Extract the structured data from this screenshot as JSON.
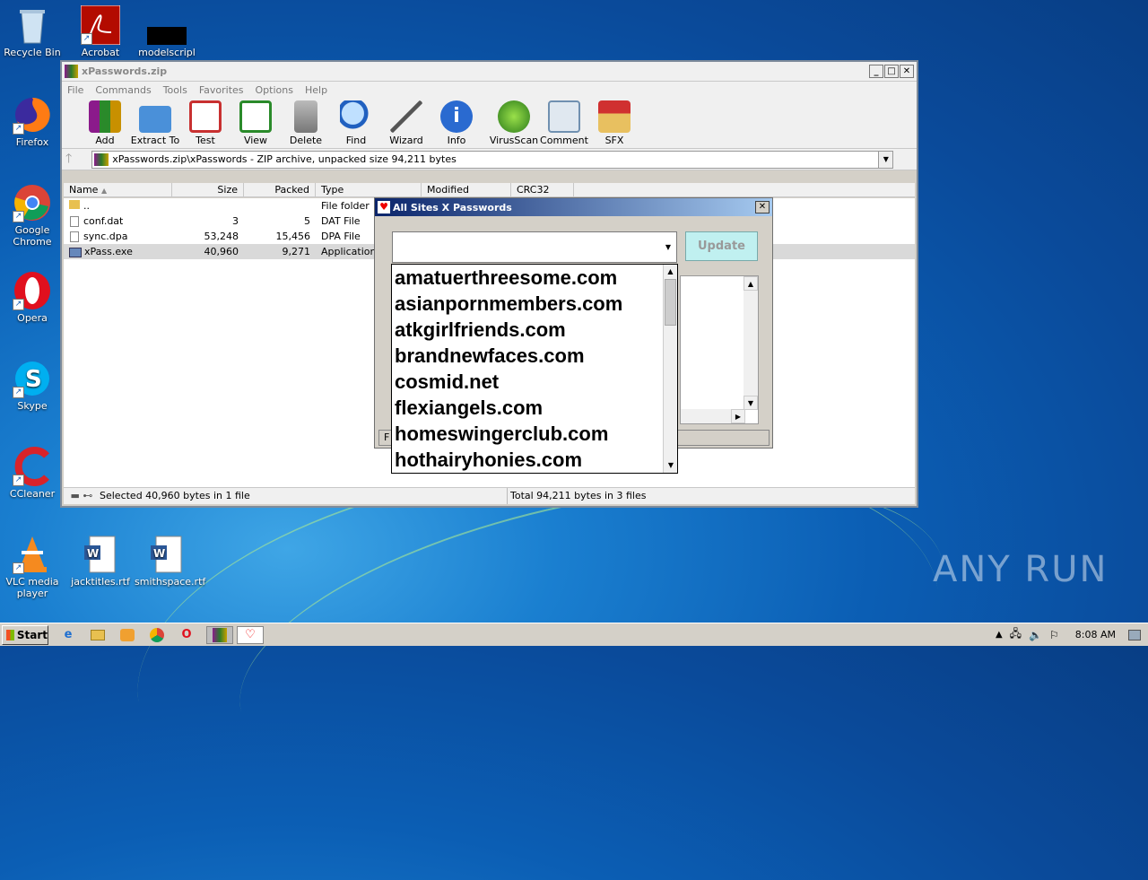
{
  "desktop": {
    "icons": [
      {
        "label": "Recycle Bin",
        "icon": "recycle-bin-icon"
      },
      {
        "label": "Acrobat",
        "icon": "acrobat-icon"
      },
      {
        "label": "modelscripl",
        "icon": "black-box-icon"
      },
      {
        "label": "Firefox",
        "icon": "firefox-icon"
      },
      {
        "label": "Google Chrome",
        "icon": "chrome-icon"
      },
      {
        "label": "Opera",
        "icon": "opera-icon"
      },
      {
        "label": "Skype",
        "icon": "skype-icon"
      },
      {
        "label": "CCleaner",
        "icon": "ccleaner-icon"
      },
      {
        "label": "VLC media player",
        "icon": "vlc-icon"
      },
      {
        "label": "jacktitles.rtf",
        "icon": "word-doc-icon"
      },
      {
        "label": "smithspace.rtf",
        "icon": "word-doc-icon"
      }
    ]
  },
  "winrar": {
    "title": "xPasswords.zip",
    "menu": [
      "File",
      "Commands",
      "Tools",
      "Favorites",
      "Options",
      "Help"
    ],
    "toolbar": [
      "Add",
      "Extract To",
      "Test",
      "View",
      "Delete",
      "Find",
      "Wizard",
      "Info",
      "VirusScan",
      "Comment",
      "SFX"
    ],
    "address": "xPasswords.zip\\xPasswords - ZIP archive, unpacked size 94,211 bytes",
    "columns": [
      "Name",
      "Size",
      "Packed",
      "Type",
      "Modified",
      "CRC32"
    ],
    "rows": [
      {
        "name": "..",
        "size": "",
        "packed": "",
        "type": "File folder"
      },
      {
        "name": "conf.dat",
        "size": "3",
        "packed": "5",
        "type": "DAT File"
      },
      {
        "name": "sync.dpa",
        "size": "53,248",
        "packed": "15,456",
        "type": "DPA File"
      },
      {
        "name": "xPass.exe",
        "size": "40,960",
        "packed": "9,271",
        "type": "Application"
      }
    ],
    "status_left": "Selected 40,960 bytes in 1 file",
    "status_right": "Total 94,211 bytes in 3 files"
  },
  "dialog": {
    "title": "All Sites X Passwords",
    "update_label": "Update",
    "partial_label": "F",
    "sites": [
      "amatuerthreesome.com",
      "asianpornmembers.com",
      "atkgirlfriends.com",
      "brandnewfaces.com",
      "cosmid.net",
      "flexiangels.com",
      "homeswingerclub.com",
      "hothairyhonies.com"
    ]
  },
  "taskbar": {
    "start_label": "Start",
    "clock": "8:08 AM"
  },
  "watermark": "ANY RUN"
}
